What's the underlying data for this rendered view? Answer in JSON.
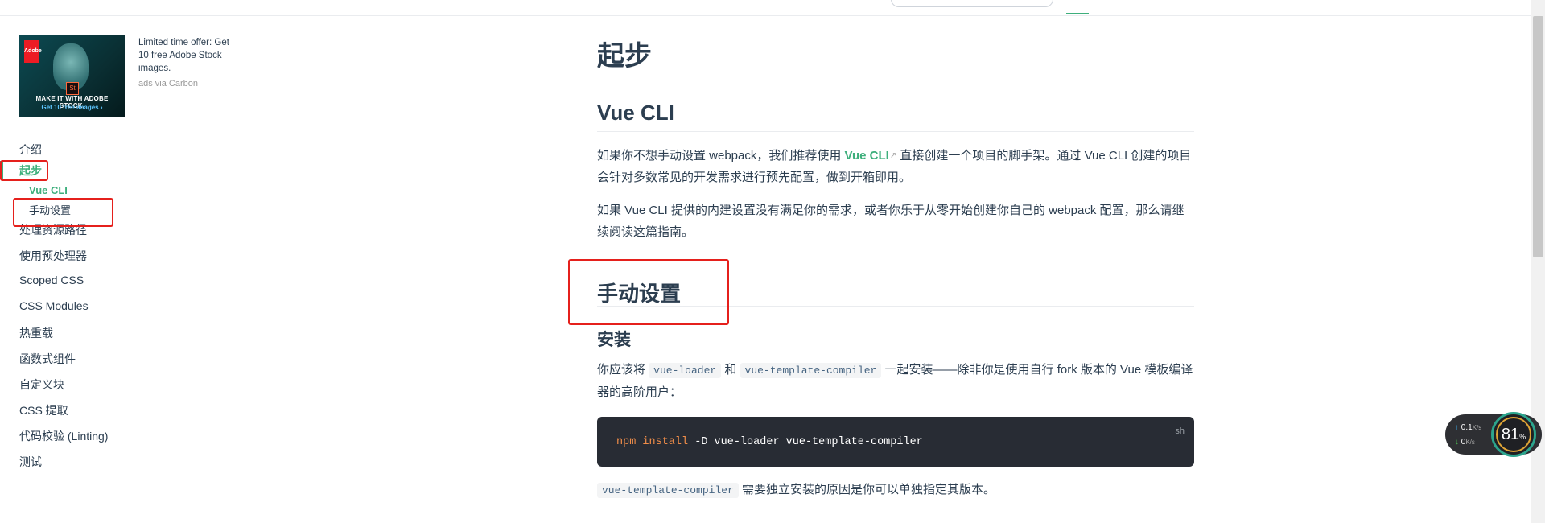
{
  "ad": {
    "image_logo": "Adobe",
    "image_badge": "St",
    "image_headline": "MAKE IT WITH ADOBE STOCK.",
    "image_cta": "Get 10 free images ›",
    "text": "Limited time offer: Get 10 free Adobe Stock images.",
    "via": "ads via Carbon"
  },
  "sidebar": {
    "items": [
      {
        "label": "介绍"
      },
      {
        "label": "起步",
        "active": true
      },
      {
        "label": "处理资源路径"
      },
      {
        "label": "使用预处理器"
      },
      {
        "label": "Scoped CSS"
      },
      {
        "label": "CSS Modules"
      },
      {
        "label": "热重载"
      },
      {
        "label": "函数式组件"
      },
      {
        "label": "自定义块"
      },
      {
        "label": "CSS 提取"
      },
      {
        "label": "代码校验 (Linting)"
      },
      {
        "label": "测试"
      }
    ],
    "subitems": [
      {
        "label": "Vue CLI",
        "active": true
      },
      {
        "label": "手动设置"
      }
    ]
  },
  "content": {
    "title": "起步",
    "section1": {
      "heading": "Vue CLI",
      "p1_before": "如果你不想手动设置 webpack，我们推荐使用 ",
      "p1_link": "Vue CLI",
      "p1_after": " 直接创建一个项目的脚手架。通过 Vue CLI 创建的项目会针对多数常见的开发需求进行预先配置，做到开箱即用。",
      "p2": "如果 Vue CLI 提供的内建设置没有满足你的需求，或者你乐于从零开始创建你自己的 webpack 配置，那么请继续阅读这篇指南。"
    },
    "section2": {
      "heading": "手动设置",
      "sub_heading": "安装",
      "p_install_1": "你应该将 ",
      "code1": "vue-loader",
      "p_install_2": " 和 ",
      "code2": "vue-template-compiler",
      "p_install_3": " 一起安装——除非你是使用自行 fork 版本的 Vue 模板编译器的高阶用户：",
      "code_lang": "sh",
      "code_cmd": "npm install",
      "code_args": " -D vue-loader vue-template-compiler",
      "p_note_code": "vue-template-compiler",
      "p_note": " 需要独立安装的原因是你可以单独指定其版本。"
    }
  },
  "net_widget": {
    "up": "0.1",
    "down": "0",
    "unit": "K/s",
    "percent": "81",
    "percent_sign": "%"
  }
}
